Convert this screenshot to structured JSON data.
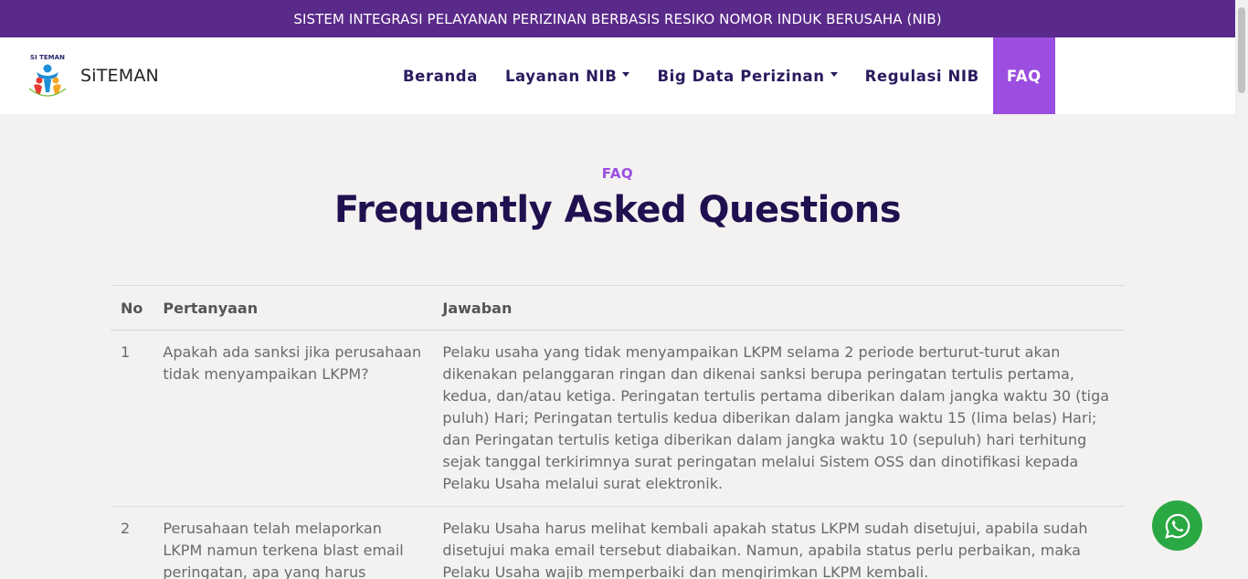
{
  "topbar": {
    "text": "SISTEM INTEGRASI PELAYANAN PERIZINAN BERBASIS RESIKO NOMOR INDUK BERUSAHA (NIB)"
  },
  "brand": {
    "name": "SiTEMAN",
    "logo_text": "SI TEMAN"
  },
  "nav": {
    "items": [
      {
        "label": "Beranda",
        "dropdown": false
      },
      {
        "label": "Layanan NIB",
        "dropdown": true
      },
      {
        "label": "Big Data Perizinan",
        "dropdown": true
      },
      {
        "label": "Regulasi NIB",
        "dropdown": false
      },
      {
        "label": "FAQ",
        "dropdown": false,
        "active": true
      }
    ]
  },
  "section": {
    "label": "FAQ",
    "title": "Frequently Asked Questions"
  },
  "table": {
    "headers": {
      "no": "No",
      "question": "Pertanyaan",
      "answer": "Jawaban"
    },
    "rows": [
      {
        "no": "1",
        "question": "Apakah ada sanksi jika perusahaan tidak menyampaikan LKPM?",
        "answer": "Pelaku usaha yang tidak menyampaikan LKPM selama 2 periode berturut-turut akan dikenakan pelanggaran ringan dan dikenai sanksi berupa peringatan tertulis pertama, kedua, dan/atau ketiga. Peringatan tertulis pertama diberikan dalam jangka waktu 30 (tiga puluh) Hari; Peringatan tertulis kedua diberikan dalam jangka waktu 15 (lima belas) Hari; dan Peringatan tertulis ketiga diberikan dalam jangka waktu 10 (sepuluh) hari terhitung sejak tanggal terkirimnya surat peringatan melalui Sistem OSS dan dinotifikasi kepada Pelaku Usaha melalui surat elektronik."
      },
      {
        "no": "2",
        "question": "Perusahaan telah melaporkan LKPM namun terkena blast email peringatan, apa yang harus",
        "answer": "Pelaku Usaha harus melihat kembali apakah status LKPM sudah disetujui, apabila sudah disetujui maka email tersebut diabaikan. Namun, apabila status perlu perbaikan, maka Pelaku Usaha wajib memperbaiki dan mengirimkan LKPM kembali."
      }
    ]
  },
  "colors": {
    "topbar": "#5a2a8a",
    "accent": "#9b4ee0",
    "title": "#1f1150",
    "whatsapp": "#2aa843"
  },
  "icons": {
    "chat": "whatsapp-icon"
  }
}
